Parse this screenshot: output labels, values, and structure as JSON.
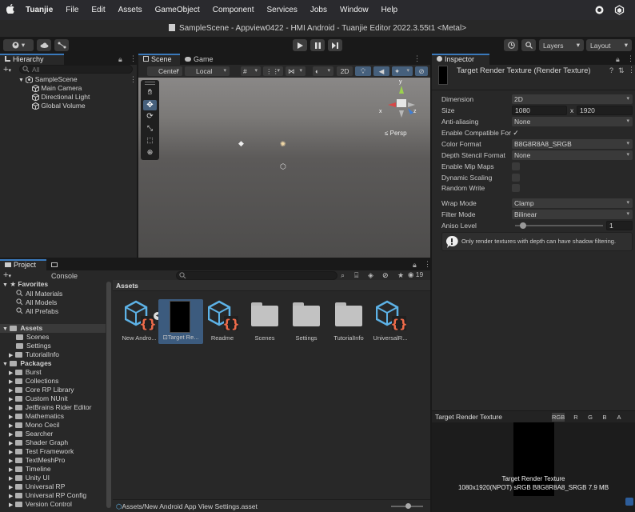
{
  "menubar": {
    "apple": "",
    "app_name": "Tuanjie",
    "items": [
      "File",
      "Edit",
      "Assets",
      "GameObject",
      "Component",
      "Services",
      "Jobs",
      "Window",
      "Help"
    ]
  },
  "titlebar": {
    "title": "SampleScene - Appview0422 - HMI Android - Tuanjie Editor 2022.3.55t1 <Metal>"
  },
  "toolbar": {
    "account_label": "",
    "layers_label": "Layers",
    "layout_label": "Layout"
  },
  "hierarchy": {
    "tab": "Hierarchy",
    "search_placeholder": "All",
    "scene": "SampleScene",
    "items": [
      "Main Camera",
      "Directional Light",
      "Global Volume"
    ]
  },
  "scene_view": {
    "tabs": [
      "Scene",
      "Game"
    ],
    "center_label": "Center",
    "local_label": "Local",
    "mode_2d": "2D",
    "persp_label": "Persp",
    "gizmo_axes": {
      "x": "x",
      "y": "y",
      "z": "z"
    }
  },
  "inspector": {
    "tab": "Inspector",
    "header": "Target Render Texture (Render Texture)",
    "props": {
      "dimension": {
        "label": "Dimension",
        "value": "2D"
      },
      "size": {
        "label": "Size",
        "w": "1080",
        "x": "x",
        "h": "1920"
      },
      "anti_aliasing": {
        "label": "Anti-aliasing",
        "value": "None"
      },
      "enable_compat": {
        "label": "Enable Compatible For",
        "check": "✓"
      },
      "color_format": {
        "label": "Color Format",
        "value": "B8G8R8A8_SRGB"
      },
      "depth_stencil": {
        "label": "Depth Stencil Format",
        "value": "None"
      },
      "mipmaps": {
        "label": "Enable Mip Maps"
      },
      "dyn_scaling": {
        "label": "Dynamic Scaling"
      },
      "random_write": {
        "label": "Random Write"
      },
      "wrap_mode": {
        "label": "Wrap Mode",
        "value": "Clamp"
      },
      "filter_mode": {
        "label": "Filter Mode",
        "value": "Bilinear"
      },
      "aniso": {
        "label": "Aniso Level",
        "value": "1"
      }
    },
    "help_text": "Only render textures with depth can have shadow filtering.",
    "preview": {
      "title": "Target Render Texture",
      "channels": [
        "RGB",
        "R",
        "G",
        "B",
        "A"
      ],
      "caption_title": "Target Render Texture",
      "caption_info": "1080x1920(NPOT) sRGB  B8G8R8A8_SRGB  7.9 MB"
    }
  },
  "project": {
    "tabs": [
      "Project",
      "Console"
    ],
    "favorites_label": "Favorites",
    "favorites": [
      "All Materials",
      "All Models",
      "All Prefabs"
    ],
    "assets_label": "Assets",
    "assets_children": [
      "Scenes",
      "Settings",
      "TutorialInfo"
    ],
    "packages_label": "Packages",
    "packages": [
      "Burst",
      "Collections",
      "Core RP Library",
      "Custom NUnit",
      "JetBrains Rider Editor",
      "Mathematics",
      "Mono Cecil",
      "Searcher",
      "Shader Graph",
      "Test Framework",
      "TextMeshPro",
      "Timeline",
      "Unity UI",
      "Universal RP",
      "Universal RP Config",
      "Version Control"
    ],
    "breadcrumb": "Assets",
    "hidden_count": "19",
    "grid_assets": [
      {
        "label": "New Andro...",
        "icon": "script-asset-icon"
      },
      {
        "label": "Target Re...",
        "icon": "render-texture-icon"
      },
      {
        "label": "Readme",
        "icon": "script-asset-icon"
      },
      {
        "label": "Scenes",
        "icon": "folder-icon"
      },
      {
        "label": "Settings",
        "icon": "folder-icon"
      },
      {
        "label": "TutorialInfo",
        "icon": "folder-icon"
      },
      {
        "label": "UniversalR...",
        "icon": "script-asset-icon"
      }
    ],
    "status_path": "Assets/New Android App View Settings.asset"
  },
  "colors": {
    "accent": "#3a79bb",
    "panel": "#282828",
    "dark": "#191919",
    "scene_sky": "#878685",
    "scene_ground": "#4d4c4b"
  }
}
